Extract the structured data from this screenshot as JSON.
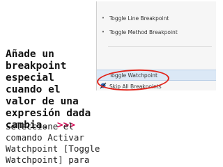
{
  "slide": {
    "heading": "Añade un breakpoint especial cuando el valor de una expresión dada cambia.",
    "arrows": ">>>",
    "body": "Seleccione el comando Activar Watchpoint [Toggle Watchpoint] para"
  },
  "menu": {
    "items": [
      {
        "label": "Toggle Line Breakpoint",
        "icon": "dot-icon"
      },
      {
        "label": "Toggle Method Breakpoint",
        "icon": "dot-icon"
      },
      {
        "label": "Toggle Watchpoint",
        "icon": "none",
        "highlighted": true
      },
      {
        "label": "Skip All Breakpoints",
        "icon": "skip-breakpoints-icon"
      }
    ]
  },
  "colors": {
    "arrows": "#d81b60",
    "ring": "#e2231a",
    "highlight": "#dbe8f6"
  }
}
